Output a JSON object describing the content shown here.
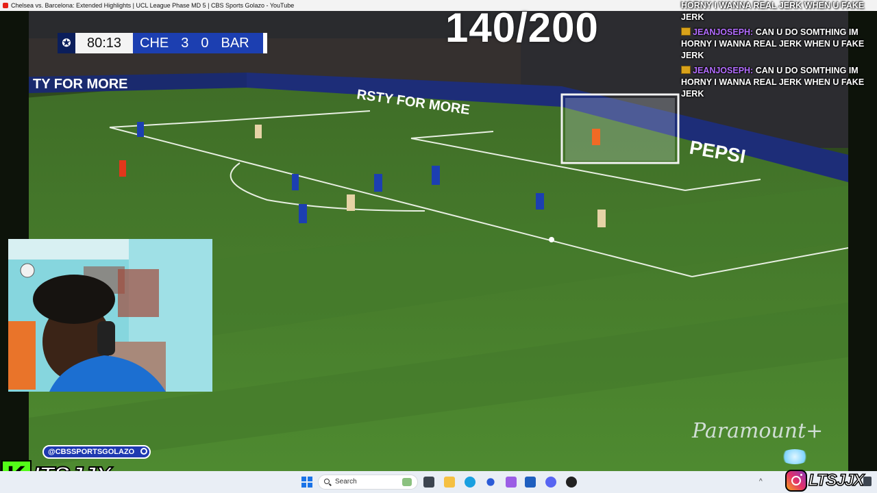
{
  "window": {
    "title": "Chelsea vs. Barcelona: Extended Highlights | UCL League Phase MD 5 | CBS Sports Golazo - YouTube"
  },
  "scoreboard": {
    "clock": "80:13",
    "home_team": "CHE",
    "home_score": "3",
    "away_score": "0",
    "away_team": "BAR"
  },
  "overlay": {
    "counter": "140/200",
    "handle": "@CBSSPORTSGOLAZO",
    "broadcaster": "Paramount+",
    "ad_banner": "TY FOR MORE",
    "ad_banner_2": "RSTY FOR MORE",
    "sponsor": "PEPSI"
  },
  "chat": {
    "partial_message": "HORNY I WANNA REAL JERK WHEN U FAKE JERK",
    "messages": [
      {
        "user": "JEANJOSEPH:",
        "text": "CAN U DO SOMTHING IM HORNY I WANNA REAL JERK WHEN U FAKE JERK"
      },
      {
        "user": "JEANJOSEPH:",
        "text": "CAN U DO SOMTHING IM HORNY I WANNA REAL JERK WHEN U FAKE JERK"
      }
    ]
  },
  "branding": {
    "kick_letter": "K",
    "kick_name": "ITSJJX",
    "instagram_name": "LTSJJX"
  },
  "taskbar": {
    "search_placeholder": "Search"
  },
  "colors": {
    "pitch": "#3e6b27",
    "chelsea_blue": "#1c3fb1",
    "barca_kit": "#e6d3a6",
    "chat_user": "#b36cff",
    "kick_green": "#53fc18"
  }
}
